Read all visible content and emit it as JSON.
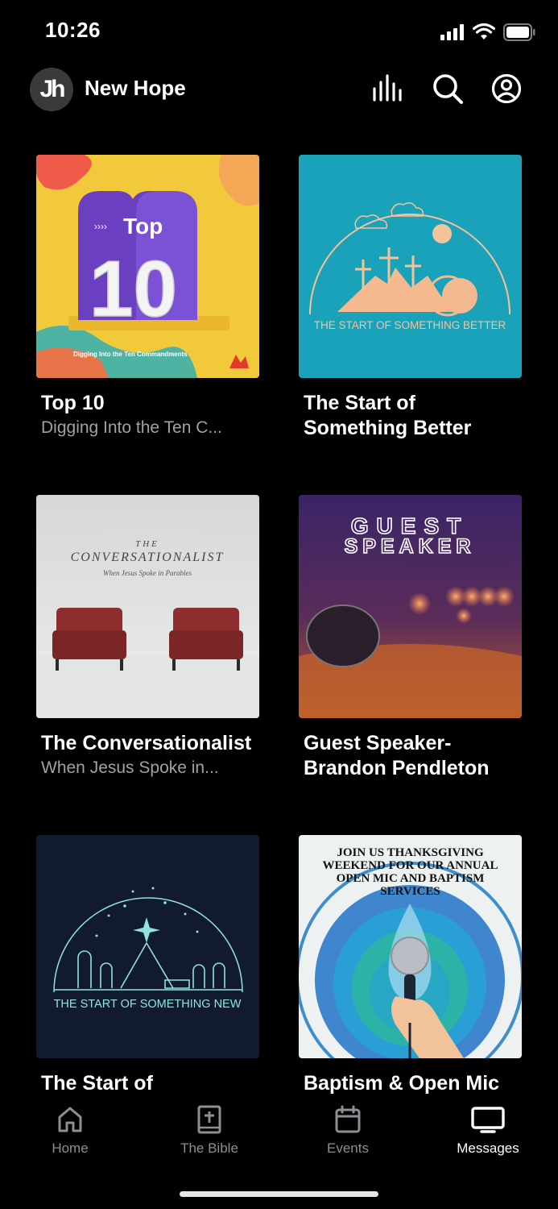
{
  "status": {
    "time": "10:26"
  },
  "header": {
    "avatar_text": "Jh",
    "title": "New Hope"
  },
  "cards": [
    {
      "title": "Top 10",
      "subtitle": "Digging Into the Ten C...",
      "art_text": "Top",
      "art_number": "10",
      "art_caption": "Digging Into the Ten Commandments"
    },
    {
      "title": "The Start of Something Better",
      "subtitle": "",
      "art_caption": "THE START OF SOMETHING BETTER"
    },
    {
      "title": "The Conversationalist",
      "subtitle": "When Jesus Spoke in...",
      "art_small": "THE",
      "art_big": "CONVERSATIONALIST",
      "art_script": "When Jesus Spoke in Parables"
    },
    {
      "title": "Guest Speaker- Brandon Pendleton",
      "subtitle": "",
      "art_line1": "GUEST",
      "art_line2": "SPEAKER"
    },
    {
      "title": "The Start of",
      "subtitle": "",
      "art_caption": "THE START OF SOMETHING NEW"
    },
    {
      "title": "Baptism & Open Mic",
      "subtitle": "",
      "art_text": "JOIN US THANKSGIVING WEEKEND FOR OUR ANNUAL OPEN MIC AND BAPTISM SERVICES"
    }
  ],
  "tabs": [
    {
      "label": "Home",
      "icon": "home-icon",
      "active": false
    },
    {
      "label": "The Bible",
      "icon": "bible-icon",
      "active": false
    },
    {
      "label": "Events",
      "icon": "calendar-icon",
      "active": false
    },
    {
      "label": "Messages",
      "icon": "tv-icon",
      "active": true
    }
  ],
  "colors": {
    "background": "#000000",
    "subtitle": "#a1a1a6",
    "tab_inactive": "#8e8e93",
    "tab_active": "#ffffff"
  }
}
